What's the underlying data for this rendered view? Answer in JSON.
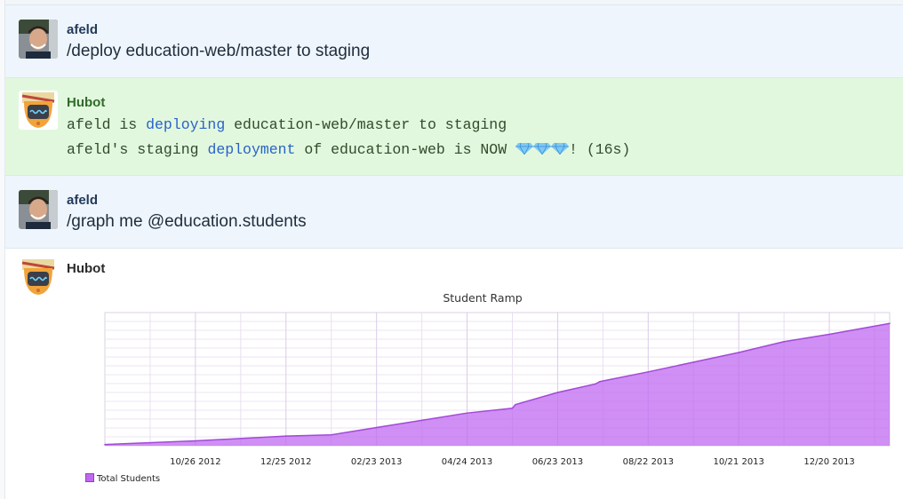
{
  "messages": [
    {
      "author": "afeld",
      "text": "/deploy education-web/master to staging"
    },
    {
      "author": "Hubot",
      "line1": {
        "a": "afeld is ",
        "kw": "deploying",
        "b": " education-web/master to staging"
      },
      "line2": {
        "a": "afeld's staging ",
        "kw": "deployment",
        "b": " of education-web is NOW ",
        "c": "! (16s)"
      }
    },
    {
      "author": "afeld",
      "text": "/graph me @education.students"
    },
    {
      "author": "Hubot"
    }
  ],
  "colors": {
    "user_bg": "#eef5fc",
    "bot_bg": "#e2f8de",
    "series": "#c069f0",
    "keyword": "#2a62c9"
  },
  "chart_data": {
    "type": "area",
    "title": "Student Ramp",
    "xlabel": "",
    "ylabel": "",
    "x_ticks": [
      "10/26 2012",
      "12/25 2012",
      "02/23 2013",
      "04/24 2013",
      "06/23 2013",
      "08/22 2013",
      "10/21 2013",
      "12/20 2013"
    ],
    "series": [
      {
        "name": "Total Students",
        "x": [
          "2012-08-27",
          "2012-10-26",
          "2012-12-25",
          "2013-01-24",
          "2013-02-23",
          "2013-03-25",
          "2013-04-24",
          "2013-05-24",
          "2013-05-26",
          "2013-06-23",
          "2013-07-18",
          "2013-07-21",
          "2013-08-22",
          "2013-09-21",
          "2013-10-21",
          "2013-11-20",
          "2013-12-20",
          "2014-01-29"
        ],
        "values": [
          1,
          4,
          8,
          9,
          15,
          21,
          27,
          31,
          34,
          44,
          51,
          53,
          61,
          69,
          77,
          86,
          92,
          101
        ]
      }
    ],
    "ylim": [
      0,
      110
    ],
    "grid": true,
    "legend": "bottom-left"
  }
}
